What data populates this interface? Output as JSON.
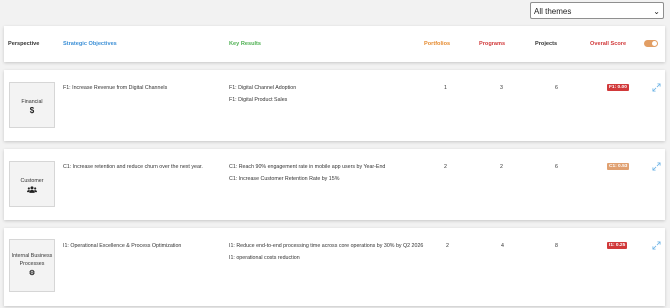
{
  "theme_select": {
    "value": "All themes"
  },
  "header": {
    "perspective": "Perspective",
    "objectives": "Strategic Objectives",
    "key_results": "Key Results",
    "portfolios": "Portfolios",
    "programs": "Programs",
    "projects": "Projects",
    "overall_score": "Overall Score"
  },
  "colors": {
    "objectives": "#3b8fd6",
    "key_results": "#4caf50",
    "portfolios": "#e58a2e",
    "programs": "#d1393a",
    "score_red": "#d1393a",
    "score_orange": "#e0a070",
    "toggle_on": "#e29e64"
  },
  "rows": [
    {
      "perspective": "Financial",
      "icon": "dollar-icon",
      "objective": "F1: Increase Revenue from Digital Channels",
      "key_results": [
        "F1: Digital Channel Adoption",
        "F1: Digital Product Sales"
      ],
      "portfolios": "1",
      "programs": "3",
      "projects": "6",
      "score": "F1: 0.00"
    },
    {
      "perspective": "Customer",
      "icon": "users-icon",
      "objective": "C1: Increase retention and reduce churn over the next year.",
      "key_results": [
        "C1: Reach 90% engagement rate in mobile app users by Year-End",
        "C1: Increase Customer Retention Rate by 15%"
      ],
      "portfolios": "2",
      "programs": "2",
      "projects": "6",
      "score": "C1: 0.53"
    },
    {
      "perspective": "Internal Business Processes",
      "icon": "cogs-icon",
      "objective": "I1: Operational Excellence & Process Optimization",
      "key_results": [
        "I1: Reduce end-to-end processing time across core operations by 30% by Q2 2026",
        "I1: operational costs reduction"
      ],
      "portfolios": "2",
      "programs": "4",
      "projects": "8",
      "score": "I1: 0.25"
    }
  ]
}
